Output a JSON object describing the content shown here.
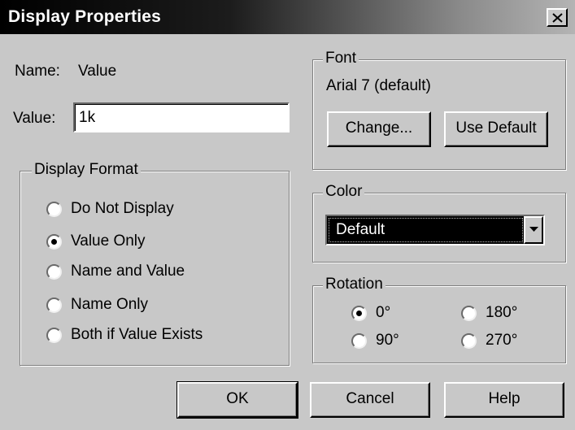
{
  "window": {
    "title": "Display Properties",
    "close_label": "X"
  },
  "name_row": {
    "label": "Name:",
    "value": "Value"
  },
  "value_row": {
    "label": "Value:",
    "value": "1k"
  },
  "display_format": {
    "legend": "Display Format",
    "options": [
      {
        "label": "Do Not Display",
        "checked": false
      },
      {
        "label": "Value Only",
        "checked": true
      },
      {
        "label": "Name and Value",
        "checked": false
      },
      {
        "label": "Name Only",
        "checked": false
      },
      {
        "label": "Both if Value Exists",
        "checked": false
      }
    ]
  },
  "font": {
    "legend": "Font",
    "current": "Arial 7 (default)",
    "change_label": "Change...",
    "use_default_label": "Use Default"
  },
  "color": {
    "legend": "Color",
    "selected": "Default"
  },
  "rotation": {
    "legend": "Rotation",
    "options": [
      {
        "label": "0°",
        "checked": true
      },
      {
        "label": "180°",
        "checked": false
      },
      {
        "label": "90°",
        "checked": false
      },
      {
        "label": "270°",
        "checked": false
      }
    ]
  },
  "buttons": {
    "ok": "OK",
    "cancel": "Cancel",
    "help": "Help"
  }
}
